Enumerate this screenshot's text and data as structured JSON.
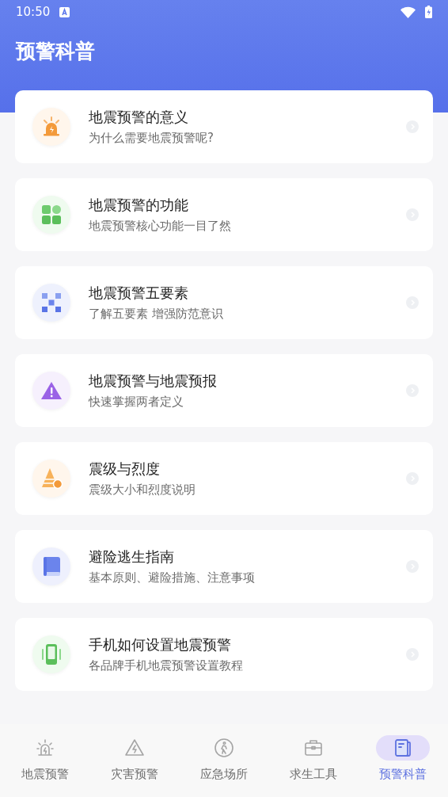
{
  "status_bar": {
    "time": "10:50"
  },
  "header": {
    "title": "预警科普"
  },
  "cards": [
    {
      "kind": "siren",
      "title": "地震预警的意义",
      "subtitle": "为什么需要地震预警呢?"
    },
    {
      "kind": "grid",
      "title": "地震预警的功能",
      "subtitle": "地震预警核心功能一目了然"
    },
    {
      "kind": "checker",
      "title": "地震预警五要素",
      "subtitle": "了解五要素 增强防范意识"
    },
    {
      "kind": "warning",
      "title": "地震预警与地震预报",
      "subtitle": "快速掌握两者定义"
    },
    {
      "kind": "pyramid",
      "title": "震级与烈度",
      "subtitle": "震级大小和烈度说明"
    },
    {
      "kind": "book",
      "title": "避险逃生指南",
      "subtitle": "基本原则、避险措施、注意事项"
    },
    {
      "kind": "phone",
      "title": "手机如何设置地震预警",
      "subtitle": "各品牌手机地震预警设置教程"
    }
  ],
  "nav": [
    {
      "kind": "siren",
      "label": "地震预警",
      "selected": false
    },
    {
      "kind": "bolt",
      "label": "灾害预警",
      "selected": false
    },
    {
      "kind": "walker",
      "label": "应急场所",
      "selected": false
    },
    {
      "kind": "toolbox",
      "label": "求生工具",
      "selected": false
    },
    {
      "kind": "book",
      "label": "预警科普",
      "selected": true
    }
  ]
}
